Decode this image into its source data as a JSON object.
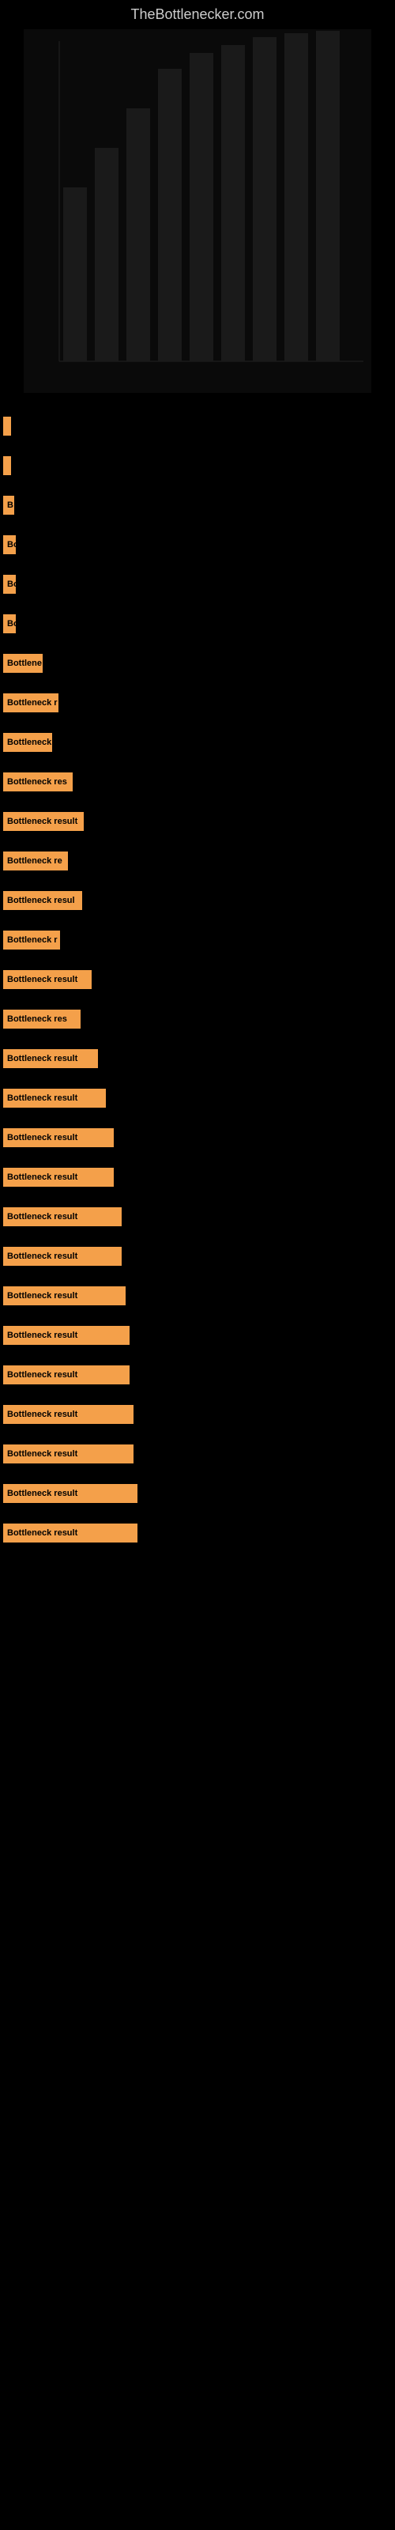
{
  "site": {
    "title": "TheBottlenecker.com"
  },
  "chart": {
    "has_content": true
  },
  "results": [
    {
      "id": 1,
      "label": "",
      "bar_class": "bar-w-10"
    },
    {
      "id": 2,
      "label": "",
      "bar_class": "bar-w-10"
    },
    {
      "id": 3,
      "label": "",
      "bar_class": "bar-w-10"
    },
    {
      "id": 4,
      "label": "",
      "bar_class": "bar-w-14"
    },
    {
      "id": 5,
      "label": "B",
      "bar_class": "bar-w-14"
    },
    {
      "id": 6,
      "label": "B",
      "bar_class": "bar-w-18"
    },
    {
      "id": 7,
      "label": "B",
      "bar_class": "bar-w-18"
    },
    {
      "id": 8,
      "label": "Bottlene",
      "bar_class": "bar-w-50"
    },
    {
      "id": 9,
      "label": "Bottleneck r",
      "bar_class": "bar-w-70"
    },
    {
      "id": 10,
      "label": "Bottleneck",
      "bar_class": "bar-w-60"
    },
    {
      "id": 11,
      "label": "Bottleneck res",
      "bar_class": "bar-w-90"
    },
    {
      "id": 12,
      "label": "Bottleneck result",
      "bar_class": "bar-w-100"
    },
    {
      "id": 13,
      "label": "Bottleneck re",
      "bar_class": "bar-w-80"
    },
    {
      "id": 14,
      "label": "Bottleneck resul",
      "bar_class": "bar-w-100"
    },
    {
      "id": 15,
      "label": "Bottleneck r",
      "bar_class": "bar-w-70"
    },
    {
      "id": 16,
      "label": "Bottleneck result",
      "bar_class": "bar-w-110"
    },
    {
      "id": 17,
      "label": "Bottleneck res",
      "bar_class": "bar-w-100"
    },
    {
      "id": 18,
      "label": "Bottleneck result",
      "bar_class": "bar-w-120"
    },
    {
      "id": 19,
      "label": "Bottleneck result",
      "bar_class": "bar-w-130"
    },
    {
      "id": 20,
      "label": "Bottleneck result",
      "bar_class": "bar-w-140"
    },
    {
      "id": 21,
      "label": "Bottleneck result",
      "bar_class": "bar-w-140"
    },
    {
      "id": 22,
      "label": "Bottleneck result",
      "bar_class": "bar-w-150"
    },
    {
      "id": 23,
      "label": "Bottleneck result",
      "bar_class": "bar-w-150"
    },
    {
      "id": 24,
      "label": "Bottleneck result",
      "bar_class": "bar-w-155"
    },
    {
      "id": 25,
      "label": "Bottleneck result",
      "bar_class": "bar-w-160"
    },
    {
      "id": 26,
      "label": "Bottleneck result",
      "bar_class": "bar-w-160"
    },
    {
      "id": 27,
      "label": "Bottleneck result",
      "bar_class": "bar-w-165"
    },
    {
      "id": 28,
      "label": "Bottleneck result",
      "bar_class": "bar-w-165"
    },
    {
      "id": 29,
      "label": "Bottleneck result",
      "bar_class": "bar-w-170"
    },
    {
      "id": 30,
      "label": "Bottleneck result",
      "bar_class": "bar-w-170"
    }
  ],
  "colors": {
    "background": "#000000",
    "bar": "#f4a04a",
    "text": "#cccccc"
  }
}
